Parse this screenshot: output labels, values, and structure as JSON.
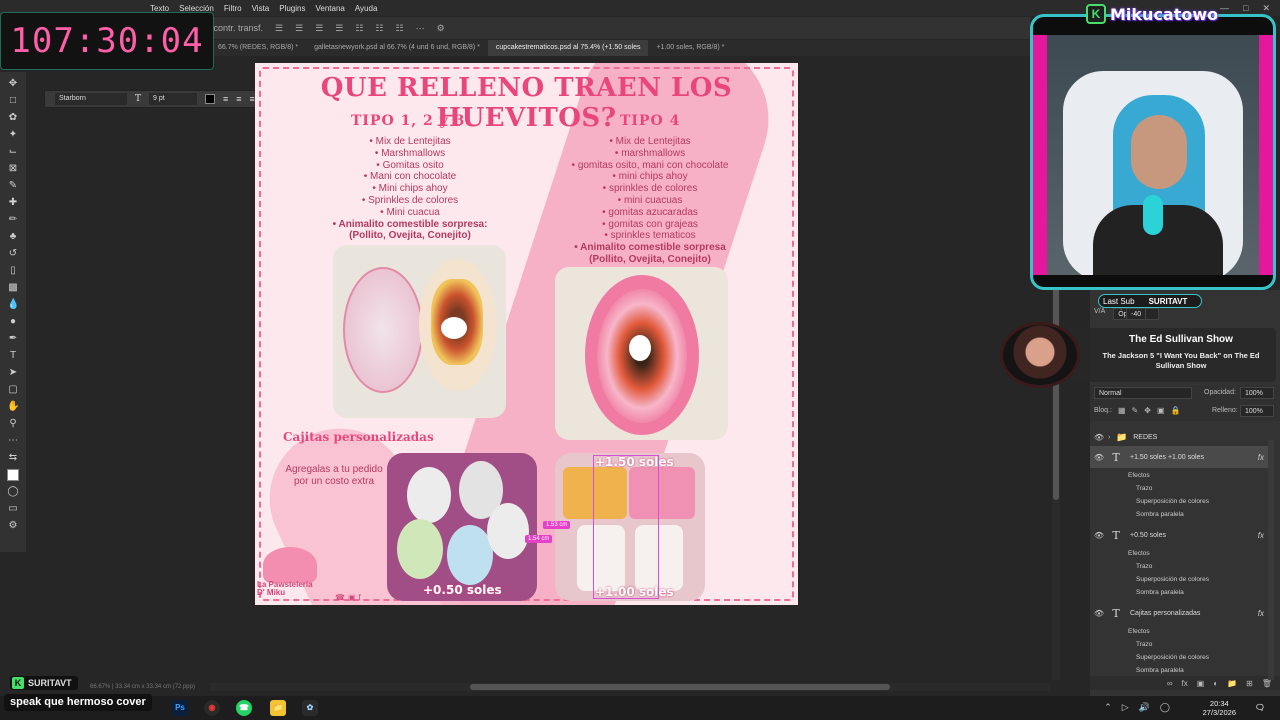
{
  "menubar": {
    "items": [
      "Texto",
      "Selección",
      "Filtro",
      "Vista",
      "Plugins",
      "Ventana",
      "Ayuda"
    ]
  },
  "optionsbar": {
    "transform_label": "r contr. transf."
  },
  "tabs": [
    {
      "label": "66.7% (REDES, RGB/8) *",
      "active": false
    },
    {
      "label": "galletasnewyork.psd al 66.7% (4 und  6 und, RGB/8) *",
      "active": false
    },
    {
      "label": "cupcakestrematicos.psd al 75.4% (+1.50 soles",
      "active": true
    },
    {
      "label": "+1.00 soles, RGB/8) *",
      "active": false
    }
  ],
  "timer": "107:30:04",
  "charbar": {
    "font": "Starborn",
    "size": "9 pt"
  },
  "canvas": {
    "headline": "QUE RELLENO TRAEN LOS HUEVITOS?",
    "col1_title": "TIPO 1, 2 y 3",
    "col1_items": [
      "Mix de Lentejitas",
      "Marshmallows",
      "Gomitas osito",
      "Mani con chocolate",
      "Mini chips ahoy",
      "Sprinkles de colores",
      "Mini cuacua"
    ],
    "col1_bold": [
      "Animalito comestible sorpresa:",
      "(Pollito, Ovejita, Conejito)"
    ],
    "col2_title": "TIPO 4",
    "col2_items": [
      "Mix de Lentejitas",
      "marshmallows",
      "gomitas osito, mani con chocolate",
      "mini chips ahoy",
      "sprinkles de colores",
      "mini cuacuas",
      "gomitas azucaradas",
      "gomitas con grajeas",
      "sprinkles tematicos"
    ],
    "col2_bold": [
      "Animalito comestible sorpresa",
      "(Pollito, Ovejita, Conejito)"
    ],
    "cajitas_title": "Cajitas personalizadas",
    "cajitas_note": "Agregalas a tu pedido por un costo extra",
    "price1": "+0.50 soles",
    "price2": "+1.50 soles",
    "price3": "+1.00 soles",
    "logo_line1": "La Pawsteleria",
    "logo_line2": "D' Miku",
    "measure1": "1.53 cm",
    "measure2": "1.54 cm"
  },
  "webcam": {
    "channel": "Mikucatowo",
    "last_sub_label": "Last Sub",
    "last_sub_value": "SURITAVT"
  },
  "music": {
    "title": "The Ed Sullivan Show",
    "subtitle": "The Jackson 5 \"I Want You Back\" on The Ed Sullivan Show"
  },
  "char_panel": {
    "va_label": "V/A",
    "va_value": "Óptica",
    "tracking": "-40"
  },
  "layer_controls": {
    "blend_mode": "Normal",
    "opacity_label": "Opacidad:",
    "opacity": "100%",
    "lock_label": "Bloq.:",
    "fill_label": "Relleno:",
    "fill": "100%"
  },
  "layers": {
    "group": "REDES",
    "selected": "+1.50 soles         +1.00 soles",
    "layer2": "+0.50 soles",
    "layer3": "Cajitas personalizadas",
    "efectos": "Efectos",
    "trazo": "Trazo",
    "superposicion": "Superposición de colores",
    "sombra": "Sombra paralela"
  },
  "chat": {
    "user": "SURITAVT",
    "message": "speak que hermoso cover"
  },
  "status": "66.67% | 33.34 cm x 33.34 cm (72 ppp)",
  "clock": {
    "time": "20:34",
    "date": "27/3/2026"
  },
  "colors": {
    "accent_pink": "#e8467d",
    "timer_pink": "#ff5fa8",
    "cam_border": "#37c4c9",
    "twitch_green": "#45e06a"
  }
}
